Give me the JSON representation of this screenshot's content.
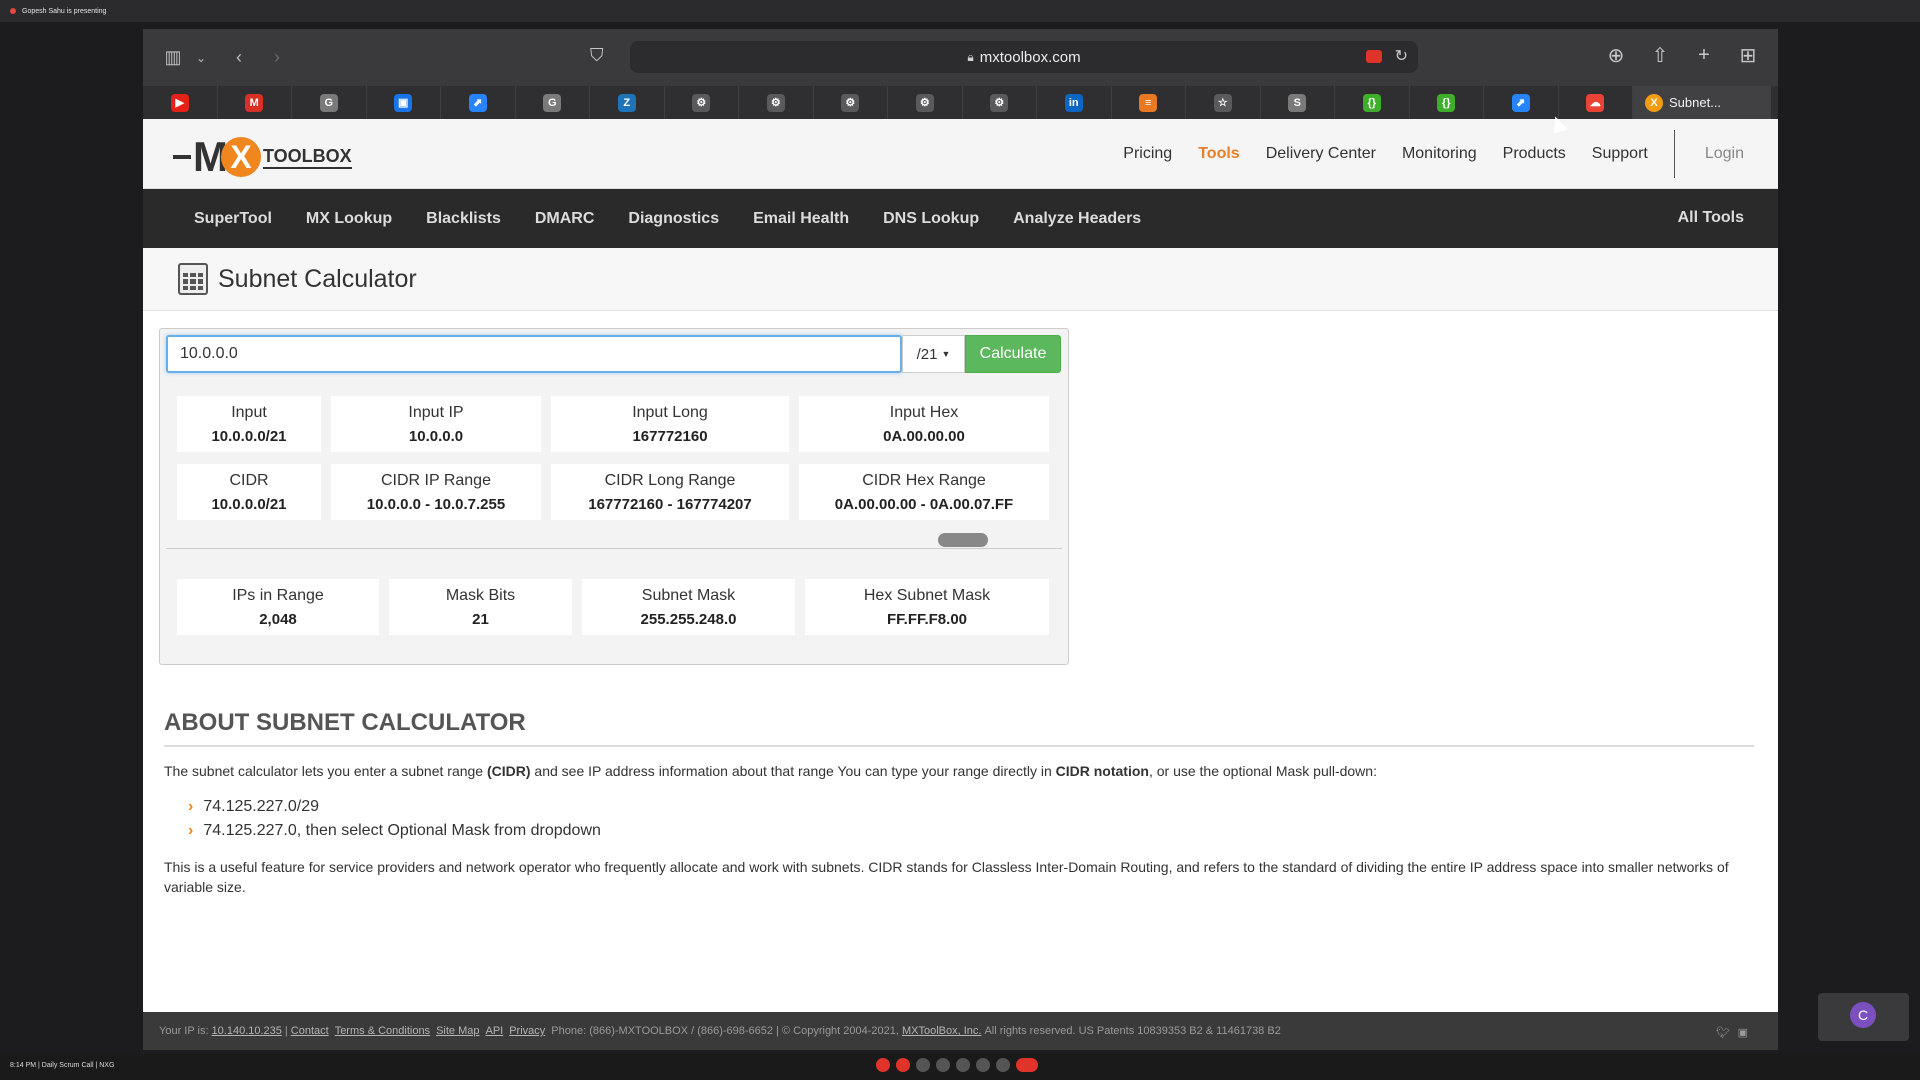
{
  "meeting": {
    "presenter_banner": "Gopesh Sahu is presenting",
    "status_left": "8:14 PM  |  Daily Scrum Call | NXG",
    "avatar_letter": "C"
  },
  "browser": {
    "url": "mxtoolbox.com",
    "active_tab_label": "Subnet...",
    "tabs": [
      {
        "icon": "youtube-icon",
        "glyph": "▶",
        "color": "#e62117"
      },
      {
        "icon": "gmail-icon",
        "glyph": "M",
        "color": "#d93025"
      },
      {
        "icon": "g-icon",
        "glyph": "G",
        "color": "#7a7a7a"
      },
      {
        "icon": "meet-icon",
        "glyph": "▣",
        "color": "#1a73e8"
      },
      {
        "icon": "jira-icon",
        "glyph": "⬈",
        "color": "#2684ff"
      },
      {
        "icon": "g-icon",
        "glyph": "G",
        "color": "#7a7a7a"
      },
      {
        "icon": "zendesk-icon",
        "glyph": "Z",
        "color": "#1f73b7"
      },
      {
        "icon": "gear-icon",
        "glyph": "⚙",
        "color": "#5a5a5c"
      },
      {
        "icon": "gear-icon",
        "glyph": "⚙",
        "color": "#5a5a5c"
      },
      {
        "icon": "gear-icon",
        "glyph": "⚙",
        "color": "#5a5a5c"
      },
      {
        "icon": "gear-icon",
        "glyph": "⚙",
        "color": "#5a5a5c"
      },
      {
        "icon": "gear-icon",
        "glyph": "⚙",
        "color": "#5a5a5c"
      },
      {
        "icon": "linkedin-icon",
        "glyph": "in",
        "color": "#0a66c2"
      },
      {
        "icon": "stackoverflow-icon",
        "glyph": "≡",
        "color": "#e87922"
      },
      {
        "icon": "star-icon",
        "glyph": "☆",
        "color": "#5a5a5c"
      },
      {
        "icon": "s-icon",
        "glyph": "S",
        "color": "#7a7a7a"
      },
      {
        "icon": "bracket-icon",
        "glyph": "{}",
        "color": "#3fae2a"
      },
      {
        "icon": "bracket-icon",
        "glyph": "{}",
        "color": "#3fae2a"
      },
      {
        "icon": "jira-icon",
        "glyph": "⬈",
        "color": "#2684ff"
      },
      {
        "icon": "cloud-icon",
        "glyph": "☁",
        "color": "#ea4335"
      }
    ]
  },
  "site": {
    "logo_mx": "M",
    "logo_x": "X",
    "logo_toolbox": "TOOLBOX",
    "nav": {
      "pricing": "Pricing",
      "tools": "Tools",
      "delivery": "Delivery Center",
      "monitoring": "Monitoring",
      "products": "Products",
      "support": "Support",
      "login": "Login"
    },
    "tool_nav": {
      "supertool": "SuperTool",
      "mx_lookup": "MX Lookup",
      "blacklists": "Blacklists",
      "dmarc": "DMARC",
      "diagnostics": "Diagnostics",
      "email_health": "Email Health",
      "dns_lookup": "DNS Lookup",
      "analyze_headers": "Analyze Headers",
      "all_tools": "All Tools"
    },
    "page_title": "Subnet Calculator"
  },
  "calculator": {
    "input_value": "10.0.0.0",
    "mask": "/21",
    "button": "Calculate",
    "results": {
      "input": {
        "label": "Input",
        "value": "10.0.0.0/21"
      },
      "input_ip": {
        "label": "Input IP",
        "value": "10.0.0.0"
      },
      "input_long": {
        "label": "Input Long",
        "value": "167772160"
      },
      "input_hex": {
        "label": "Input Hex",
        "value": "0A.00.00.00"
      },
      "cidr": {
        "label": "CIDR",
        "value": "10.0.0.0/21"
      },
      "cidr_ip_range": {
        "label": "CIDR IP Range",
        "value": "10.0.0.0 - 10.0.7.255"
      },
      "cidr_long_range": {
        "label": "CIDR Long Range",
        "value": "167772160 - 167774207"
      },
      "cidr_hex_range": {
        "label": "CIDR Hex Range",
        "value": "0A.00.00.00 - 0A.00.07.FF"
      },
      "ips_in_range": {
        "label": "IPs in Range",
        "value": "2,048"
      },
      "mask_bits": {
        "label": "Mask Bits",
        "value": "21"
      },
      "subnet_mask": {
        "label": "Subnet Mask",
        "value": "255.255.248.0"
      },
      "hex_subnet_mask": {
        "label": "Hex Subnet Mask",
        "value": "FF.FF.F8.00"
      }
    }
  },
  "about": {
    "heading": "ABOUT SUBNET CALCULATOR",
    "intro_a": "The subnet calculator lets you enter a subnet range ",
    "intro_b": "(CIDR)",
    "intro_c": " and see IP address information about that range You can type your range directly in ",
    "intro_d": "CIDR notation",
    "intro_e": ", or use the optional Mask pull-down:",
    "examples": [
      "74.125.227.0/29",
      "74.125.227.0, then select Optional Mask from dropdown"
    ],
    "outro": "This is a useful feature for service providers and network operator who frequently allocate and work with subnets. CIDR stands for Classless Inter-Domain Routing, and refers to the standard of dividing the entire IP address space into smaller networks of variable size."
  },
  "footer": {
    "ip_prefix": "Your IP is:",
    "ip": "10.140.10.235",
    "sep": "|",
    "contact": "Contact",
    "terms": "Terms & Conditions",
    "sitemap": "Site Map",
    "api": "API",
    "privacy": "Privacy",
    "phone": "Phone: (866)-MXTOOLBOX / (866)-698-6652 |  © Copyright 2004-2021,",
    "company": "MXToolBox, Inc.",
    "rights": "All rights reserved. US Patents 10839353 B2 & 11461738 B2"
  }
}
